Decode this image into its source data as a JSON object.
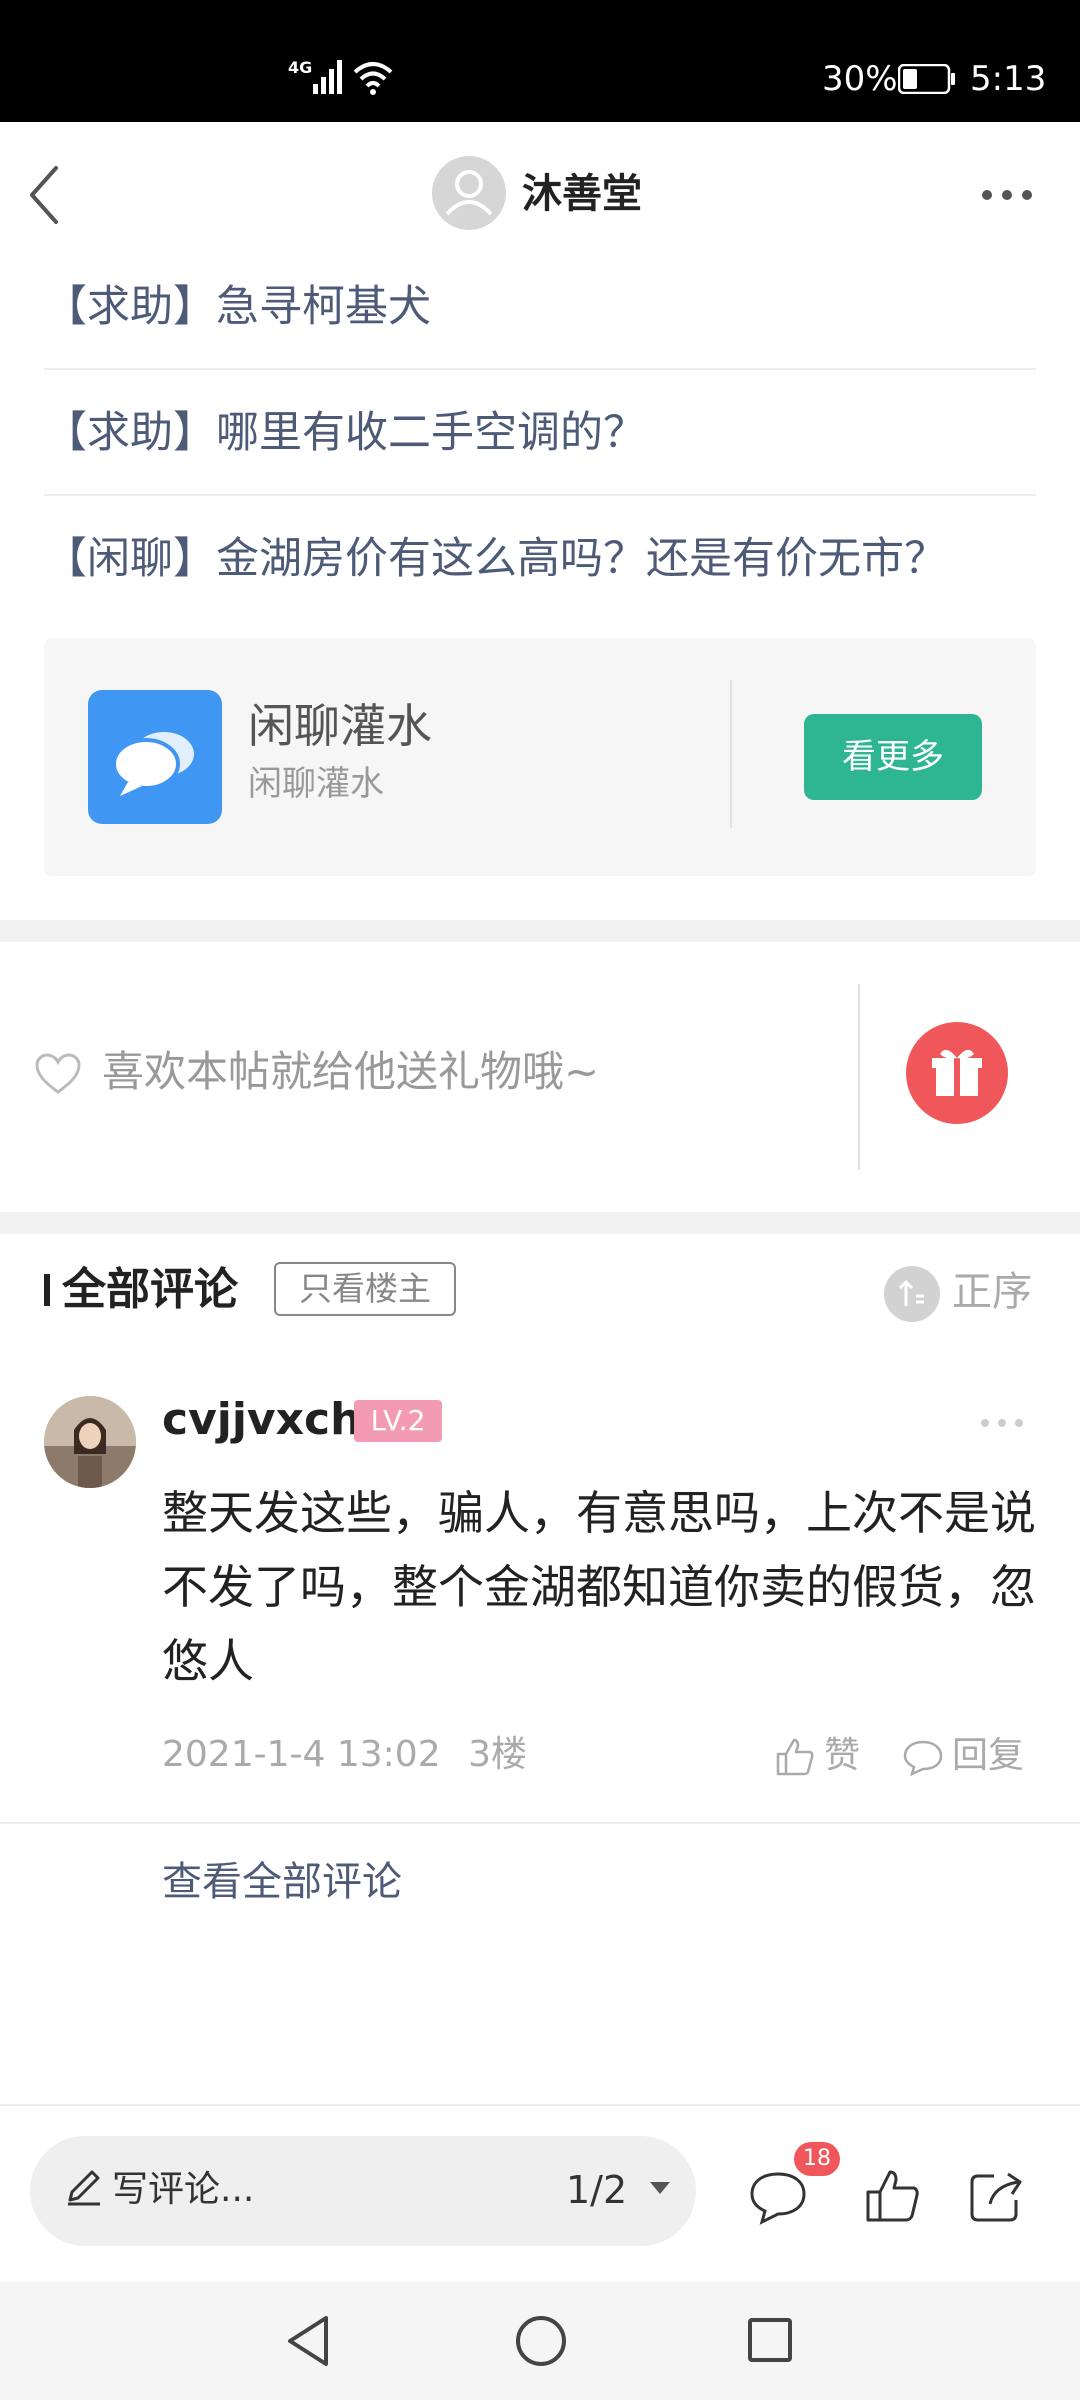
{
  "status_bar": {
    "network": "4G",
    "battery": "30%",
    "time": "5:13"
  },
  "header": {
    "title": "沐善堂",
    "back_icon": "chevron-left-icon",
    "more_icon": "more-horizontal-icon"
  },
  "related_posts": [
    "【求助】急寻柯基犬",
    "【求助】哪里有收二手空调的？",
    "【闲聊】金湖房价有这么高吗？还是有价无市？"
  ],
  "forum_card": {
    "name": "闲聊灌水",
    "subtitle": "闲聊灌水",
    "button": "看更多",
    "icon": "chat-bubbles-icon"
  },
  "gift": {
    "text": "喜欢本帖就给他送礼物哦~",
    "heart_icon": "heart-outline-icon",
    "gift_icon": "gift-icon"
  },
  "comments_section": {
    "title": "全部评论",
    "filter": "只看楼主",
    "sort": "正序"
  },
  "comment": {
    "user": "cvjjvxch",
    "level": "LV.2",
    "body": "整天发这些，骗人，有意思吗，上次不是说不发了吗，整个金湖都知道你卖的假货，忽悠人",
    "date": "2021-1-4 13:02",
    "floor": "3楼",
    "like_label": "赞",
    "reply_label": "回复"
  },
  "view_all": "查看全部评论",
  "bottom_bar": {
    "placeholder": "写评论...",
    "page": "1/2",
    "comment_count": "18"
  },
  "colors": {
    "accent_green": "#2eb693",
    "link_blue": "#4e5b78",
    "gift_red": "#f0575a",
    "level_pink": "#f39bb3",
    "forum_icon_blue": "#3f96f3"
  }
}
